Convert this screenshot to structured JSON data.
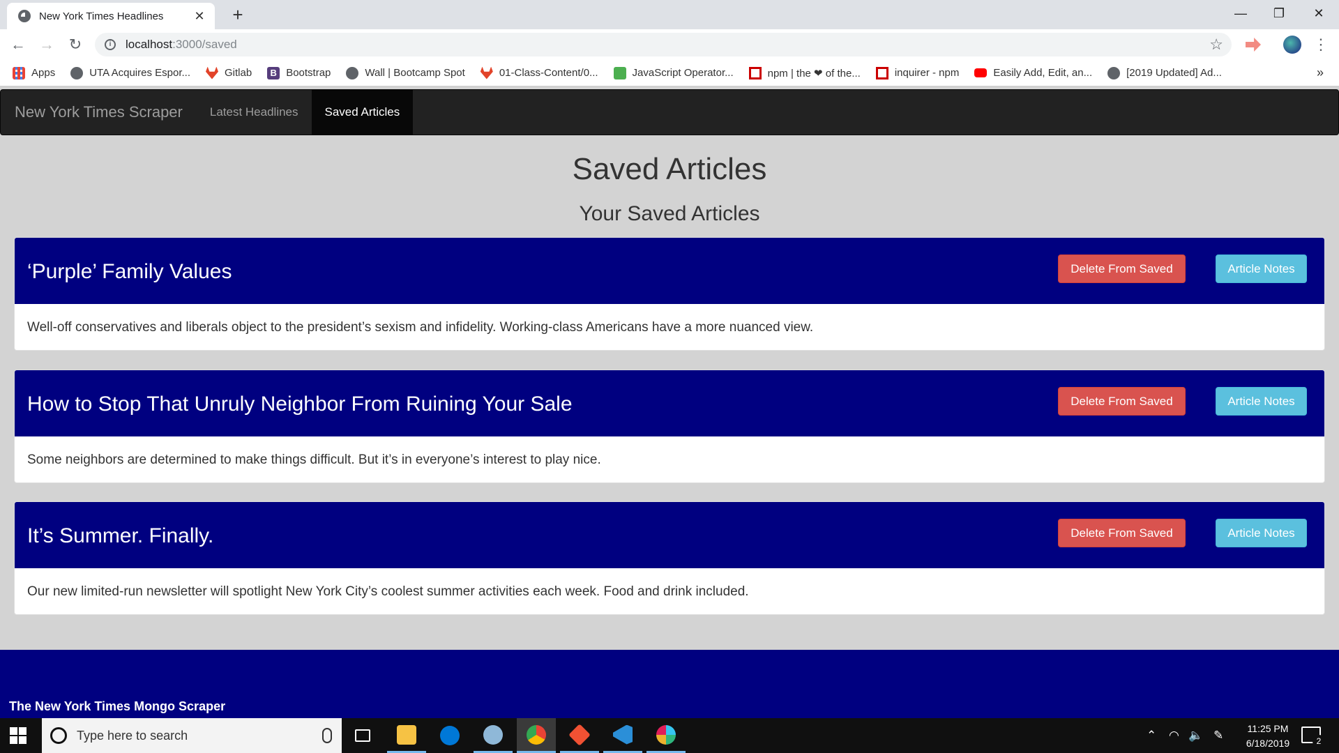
{
  "browser": {
    "tab_title": "New York Times Headlines",
    "tab_close": "✕",
    "new_tab": "+",
    "window_controls": [
      "—",
      "❐",
      "✕"
    ],
    "url_host": "localhost",
    "url_path": ":3000/saved",
    "bookmarks": [
      {
        "label": "Apps",
        "icon": "apps-grid-icon",
        "color": "#4285f4"
      },
      {
        "label": "UTA Acquires Espor...",
        "icon": "globe-icon",
        "color": "#5f6368"
      },
      {
        "label": "Gitlab",
        "icon": "gitlab-icon",
        "color": "#e24329"
      },
      {
        "label": "Bootstrap",
        "icon": "bootstrap-icon",
        "color": "#563d7c"
      },
      {
        "label": "Wall | Bootcamp Spot",
        "icon": "globe-icon",
        "color": "#5f6368"
      },
      {
        "label": "01-Class-Content/0...",
        "icon": "gitlab-icon",
        "color": "#e24329"
      },
      {
        "label": "JavaScript Operator...",
        "icon": "w3schools-icon",
        "color": "#4caf50"
      },
      {
        "label": "npm | the ❤ of the...",
        "icon": "npm-icon",
        "color": "#cb0000"
      },
      {
        "label": "inquirer - npm",
        "icon": "npm-icon",
        "color": "#cb0000"
      },
      {
        "label": "Easily Add, Edit, an...",
        "icon": "youtube-icon",
        "color": "#ff0000"
      },
      {
        "label": "[2019 Updated] Ad...",
        "icon": "globe-icon",
        "color": "#5f6368"
      }
    ],
    "bookmarks_more": "»"
  },
  "navbar": {
    "brand": "New York Times Scraper",
    "links": [
      {
        "label": "Latest Headlines"
      },
      {
        "label": "Saved Articles",
        "active": true
      }
    ]
  },
  "main": {
    "title": "Saved Articles",
    "subtitle": "Your Saved Articles",
    "delete_label": "Delete From Saved",
    "notes_label": "Article Notes",
    "articles": [
      {
        "headline": "‘Purple’ Family Values",
        "summary": "Well-off conservatives and liberals object to the president’s sexism and infidelity. Working-class Americans have a more nuanced view."
      },
      {
        "headline": "How to Stop That Unruly Neighbor From Ruining Your Sale",
        "summary": "Some neighbors are determined to make things difficult. But it’s in everyone’s interest to play nice."
      },
      {
        "headline": "It’s Summer. Finally.",
        "summary": "Our new limited-run newsletter will spotlight New York City’s coolest summer activities each week. Food and drink included."
      }
    ]
  },
  "footer": {
    "text": "The New York Times Mongo Scraper"
  },
  "taskbar": {
    "search_placeholder": "Type here to search",
    "time": "11:25 PM",
    "date": "6/18/2019",
    "notification_count": "2"
  },
  "colors": {
    "navy": "#000080",
    "danger": "#d9534f",
    "info": "#5bc0de",
    "page_bg": "#d3d3d3"
  }
}
